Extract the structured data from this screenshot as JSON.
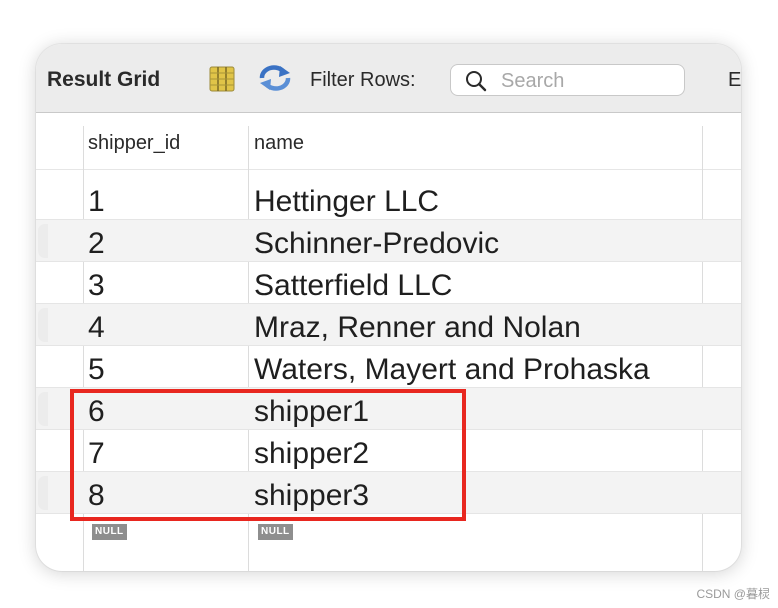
{
  "toolbar": {
    "title": "Result Grid",
    "filter_label": "Filter Rows:",
    "search_placeholder": "Search",
    "search_value": "",
    "truncated_label": "E",
    "icons": [
      "grid-layout-icon",
      "refresh-icon",
      "search-icon"
    ],
    "grid_icon_color": "#e0c448",
    "refresh_icon_color": "#3a72c4"
  },
  "table": {
    "columns": [
      "shipper_id",
      "name"
    ],
    "rows": [
      {
        "shipper_id": "1",
        "name": "Hettinger LLC"
      },
      {
        "shipper_id": "2",
        "name": "Schinner-Predovic"
      },
      {
        "shipper_id": "3",
        "name": "Satterfield LLC"
      },
      {
        "shipper_id": "4",
        "name": "Mraz, Renner and Nolan"
      },
      {
        "shipper_id": "5",
        "name": "Waters, Mayert and Prohaska"
      },
      {
        "shipper_id": "6",
        "name": "shipper1"
      },
      {
        "shipper_id": "7",
        "name": "shipper2"
      },
      {
        "shipper_id": "8",
        "name": "shipper3"
      }
    ],
    "empty_row": {
      "shipper_id": "NULL",
      "name": "NULL"
    },
    "highlighted_shipper_ids": [
      "6",
      "7",
      "8"
    ],
    "highlight_color": "#e8271f"
  },
  "watermark": "CSDN @暮棂"
}
